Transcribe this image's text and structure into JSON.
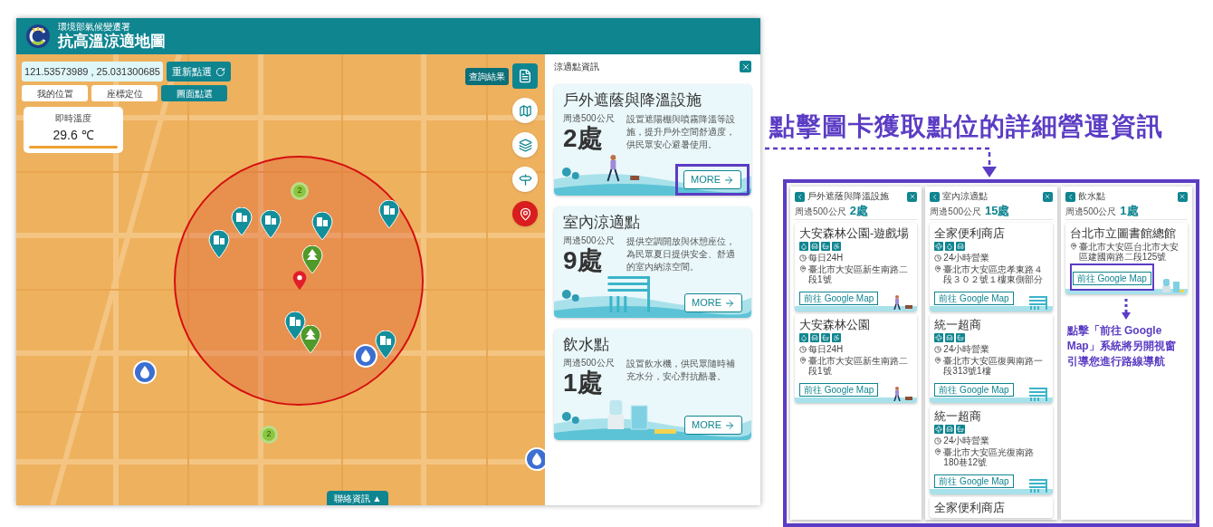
{
  "header": {
    "agency": "環境部氣候變遷署",
    "title": "抗高溫涼適地圖"
  },
  "location": {
    "coordinates": "121.53573989 , 25.031300685",
    "reselect_button": "重新點選",
    "modes": [
      {
        "label": "我的位置",
        "selected": false
      },
      {
        "label": "座標定位",
        "selected": false
      },
      {
        "label": "圖面點選",
        "selected": true
      }
    ]
  },
  "temperature": {
    "label": "即時溫度",
    "value": "29.6 ℃"
  },
  "map": {
    "results_label": "查詢結果",
    "tools": [
      {
        "kind": "map",
        "selected": false
      },
      {
        "kind": "layers",
        "selected": false
      },
      {
        "kind": "signpost",
        "selected": false
      },
      {
        "kind": "pin",
        "selected": true
      }
    ],
    "markers": [
      {
        "kind": "building"
      },
      {
        "kind": "building"
      },
      {
        "kind": "building"
      },
      {
        "kind": "building"
      },
      {
        "kind": "building"
      },
      {
        "kind": "building"
      },
      {
        "kind": "building"
      },
      {
        "kind": "tree"
      },
      {
        "kind": "tree"
      },
      {
        "kind": "location"
      },
      {
        "kind": "water"
      },
      {
        "kind": "water"
      },
      {
        "kind": "water"
      },
      {
        "kind": "cluster",
        "label": "2"
      },
      {
        "kind": "cluster",
        "label": "2"
      }
    ],
    "contact_button": "聯絡資訊 ▲"
  },
  "panel": {
    "title": "涼適點資訊",
    "cards": [
      {
        "title": "戶外遮蔭與降溫設施",
        "radius_label": "周邊500公尺",
        "count": "2處",
        "description": "設置遮陽棚與噴霧降溫等設施，提升戶外空間舒適度，供民眾安心避暑使用。",
        "more": "MORE",
        "kind": "walk",
        "highlighted": true
      },
      {
        "title": "室內涼適點",
        "radius_label": "周邊500公尺",
        "count": "9處",
        "description": "提供空調開放與休憩座位，為民眾夏日提供安全、舒適的室內納涼空間。",
        "more": "MORE",
        "kind": "building",
        "highlighted": false
      },
      {
        "title": "飲水點",
        "radius_label": "周邊500公尺",
        "count": "1處",
        "description": "設置飲水機，供民眾隨時補充水分，安心對抗酷暑。",
        "more": "MORE",
        "kind": "water",
        "highlighted": false
      }
    ]
  },
  "annotation": {
    "headline": "點擊圖卡獲取點位的詳細營運資訊",
    "screens": [
      {
        "title": "戶外遮蔭與降溫設施",
        "radius_label": "周邊500公尺",
        "count": "2處",
        "places": [
          {
            "name": "大安森林公園-遊戲場",
            "amenities": [
              {
                "kind": "water"
              },
              {
                "kind": "bench"
              },
              {
                "kind": "toilet"
              },
              {
                "kind": "accessible"
              }
            ],
            "hours": "每日24H",
            "address": "臺北市大安區新生南路二段1號",
            "map_button": "前往 Google Map",
            "highlighted": false,
            "kind": "walk"
          },
          {
            "name": "大安森林公園",
            "amenities": [
              {
                "kind": "water"
              },
              {
                "kind": "bench"
              },
              {
                "kind": "toilet"
              },
              {
                "kind": "accessible"
              }
            ],
            "hours": "每日24H",
            "address": "臺北市大安區新生南路二段1號",
            "map_button": "前往 Google Map",
            "highlighted": false,
            "kind": "walk"
          }
        ]
      },
      {
        "title": "室內涼適點",
        "radius_label": "周邊500公尺",
        "count": "15處",
        "places": [
          {
            "name": "全家便利商店",
            "amenities": [
              {
                "kind": "fan"
              },
              {
                "kind": "water"
              },
              {
                "kind": "bench"
              }
            ],
            "hours": "24小時營業",
            "address": "臺北市大安區忠孝東路４段３０２號１樓東側部分",
            "map_button": "前往 Google Map",
            "highlighted": false,
            "kind": "building"
          },
          {
            "name": "統一超商",
            "amenities": [
              {
                "kind": "fan"
              },
              {
                "kind": "bench"
              },
              {
                "kind": "toilet"
              }
            ],
            "hours": "24小時營業",
            "address": "臺北市大安區復興南路一段313號1樓",
            "map_button": "前往 Google Map",
            "highlighted": false,
            "kind": "building"
          },
          {
            "name": "統一超商",
            "amenities": [
              {
                "kind": "fan"
              },
              {
                "kind": "bench"
              },
              {
                "kind": "toilet"
              }
            ],
            "hours": "24小時營業",
            "address": "臺北市大安區光復南路180巷12號",
            "map_button": "前往 Google Map",
            "highlighted": false,
            "kind": "building"
          },
          {
            "name": "全家便利商店"
          }
        ]
      },
      {
        "title": "飲水點",
        "radius_label": "周邊500公尺",
        "count": "1處",
        "places": [
          {
            "name": "台北市立圖書館總館",
            "address": "臺北市大安區台北市大安區建國南路二段125號",
            "map_button": "前往 Google Map",
            "highlighted": true,
            "kind": "water"
          }
        ],
        "note": "點擊「前往 Google Map」系統將另開視窗引導您進行路線導航"
      }
    ]
  }
}
